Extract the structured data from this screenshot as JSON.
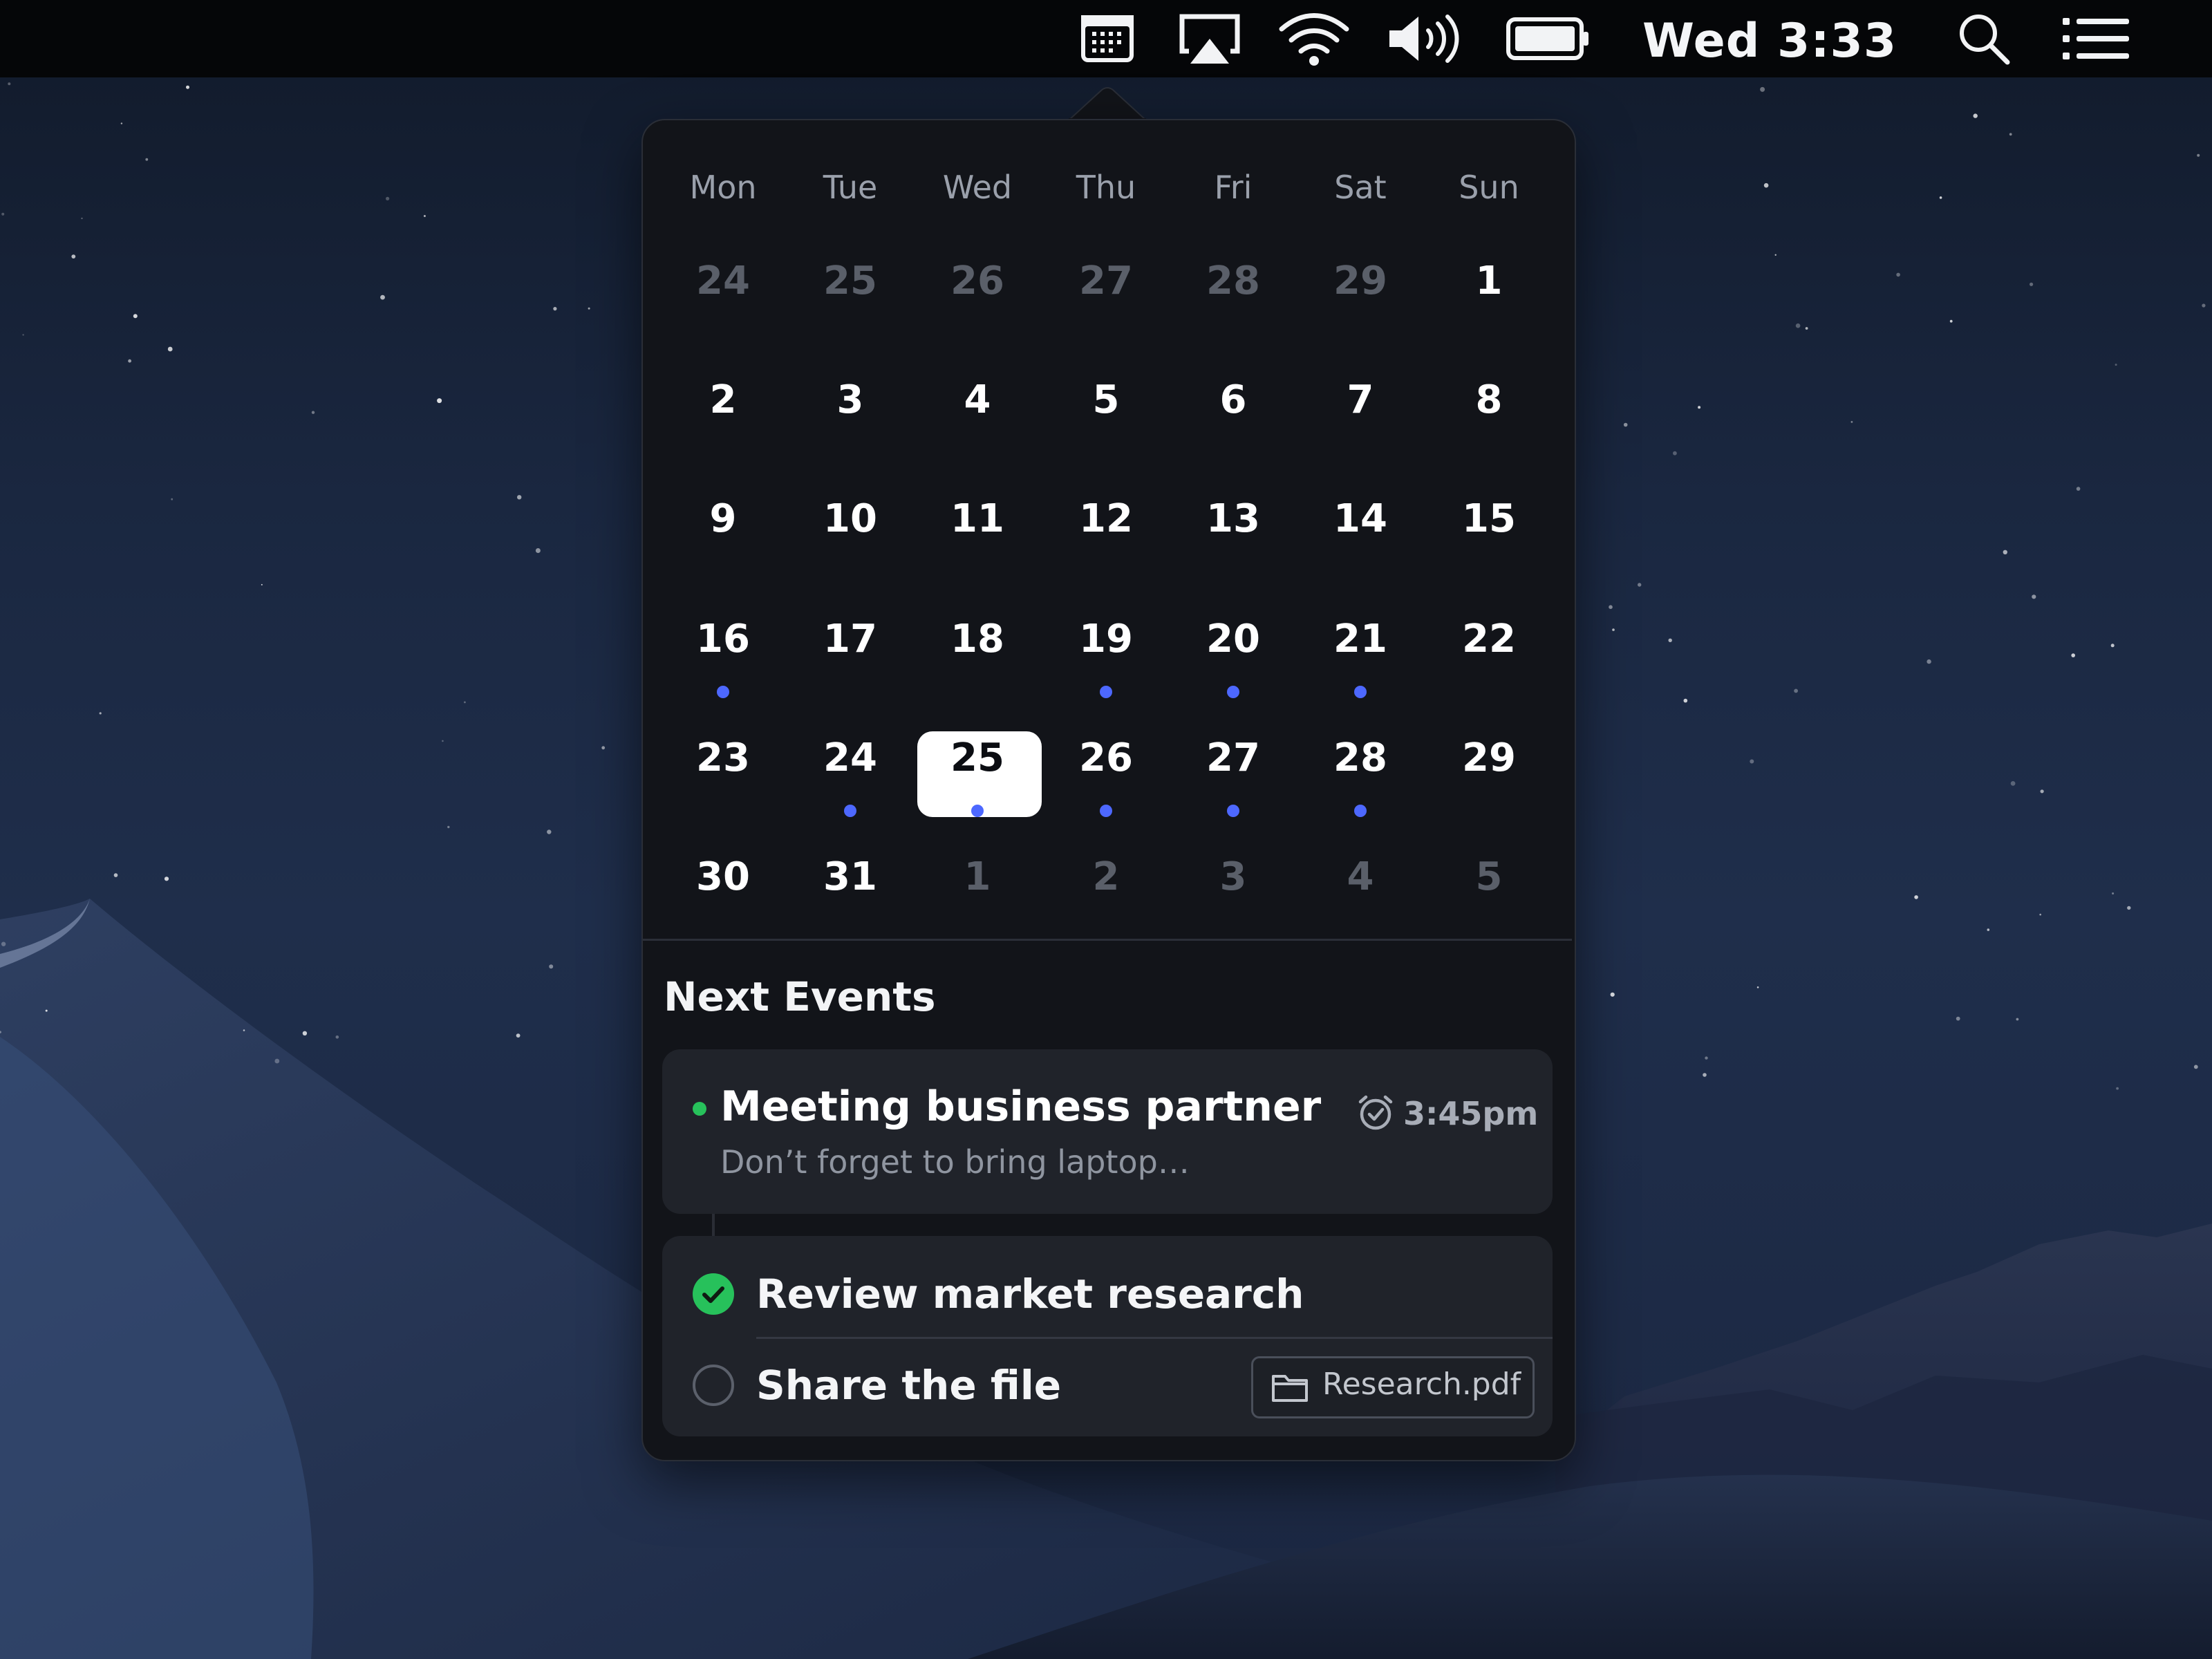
{
  "menubar": {
    "clock": "Wed 3:33",
    "icons": [
      "calendar-icon",
      "airplay-icon",
      "wifi-icon",
      "volume-icon",
      "battery-icon",
      "search-icon",
      "list-icon"
    ]
  },
  "calendar": {
    "weekdays": [
      "Mon",
      "Tue",
      "Wed",
      "Thu",
      "Fri",
      "Sat",
      "Sun"
    ],
    "weeks": [
      [
        {
          "d": "24",
          "m": true
        },
        {
          "d": "25",
          "m": true
        },
        {
          "d": "26",
          "m": true
        },
        {
          "d": "27",
          "m": true
        },
        {
          "d": "28",
          "m": true
        },
        {
          "d": "29",
          "m": true
        },
        {
          "d": "1"
        }
      ],
      [
        {
          "d": "2"
        },
        {
          "d": "3"
        },
        {
          "d": "4"
        },
        {
          "d": "5"
        },
        {
          "d": "6"
        },
        {
          "d": "7"
        },
        {
          "d": "8"
        }
      ],
      [
        {
          "d": "9"
        },
        {
          "d": "10"
        },
        {
          "d": "11"
        },
        {
          "d": "12"
        },
        {
          "d": "13"
        },
        {
          "d": "14"
        },
        {
          "d": "15"
        }
      ],
      [
        {
          "d": "16",
          "e": true
        },
        {
          "d": "17"
        },
        {
          "d": "18"
        },
        {
          "d": "19",
          "e": true
        },
        {
          "d": "20",
          "e": true
        },
        {
          "d": "21",
          "e": true
        },
        {
          "d": "22"
        }
      ],
      [
        {
          "d": "23"
        },
        {
          "d": "24",
          "e": true
        },
        {
          "d": "25",
          "e": true,
          "s": true
        },
        {
          "d": "26",
          "e": true
        },
        {
          "d": "27",
          "e": true
        },
        {
          "d": "28",
          "e": true
        },
        {
          "d": "29"
        }
      ],
      [
        {
          "d": "30"
        },
        {
          "d": "31"
        },
        {
          "d": "1",
          "m": true
        },
        {
          "d": "2",
          "m": true
        },
        {
          "d": "3",
          "m": true
        },
        {
          "d": "4",
          "m": true
        },
        {
          "d": "5",
          "m": true
        }
      ]
    ],
    "selected_day": "25",
    "event_dot_color": "#4d68ff"
  },
  "next_events": {
    "title": "Next Events",
    "event": {
      "title": "Meeting business partner",
      "subtitle": "Don’t forget to bring laptop…",
      "time": "3:45pm",
      "status_color": "#27c15b"
    },
    "tasks": [
      {
        "label": "Review market research",
        "done": true
      },
      {
        "label": "Share the file",
        "done": false,
        "attachment": "Research.pdf"
      }
    ]
  }
}
